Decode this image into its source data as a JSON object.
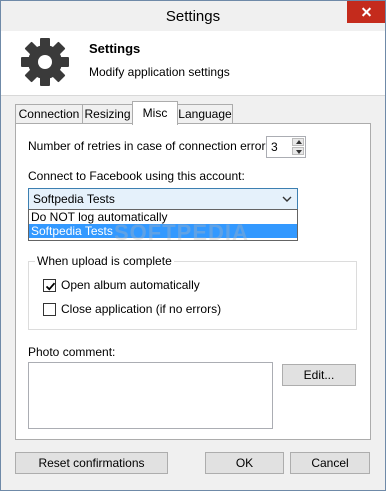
{
  "window": {
    "title": "Settings"
  },
  "header": {
    "title": "Settings",
    "subtitle": "Modify application settings"
  },
  "tabs": [
    {
      "label": "Connection"
    },
    {
      "label": "Resizing"
    },
    {
      "label": "Misc"
    },
    {
      "label": "Language"
    }
  ],
  "misc": {
    "retries_label": "Number of retries in case of connection error:",
    "retries_value": "3",
    "account_label": "Connect to Facebook using this account:",
    "account_selected": "Softpedia Tests",
    "account_options": [
      "Do NOT log automatically",
      "Softpedia Tests"
    ],
    "upload_group": "When upload is complete",
    "open_album_label": "Open album automatically",
    "open_album_checked": true,
    "close_app_label": "Close application (if no errors)",
    "close_app_checked": false,
    "photo_comment_label": "Photo comment:",
    "edit_label": "Edit..."
  },
  "watermark": "SOFTPEDIA",
  "footer": {
    "reset_label": "Reset confirmations",
    "ok_label": "OK",
    "cancel_label": "Cancel"
  }
}
